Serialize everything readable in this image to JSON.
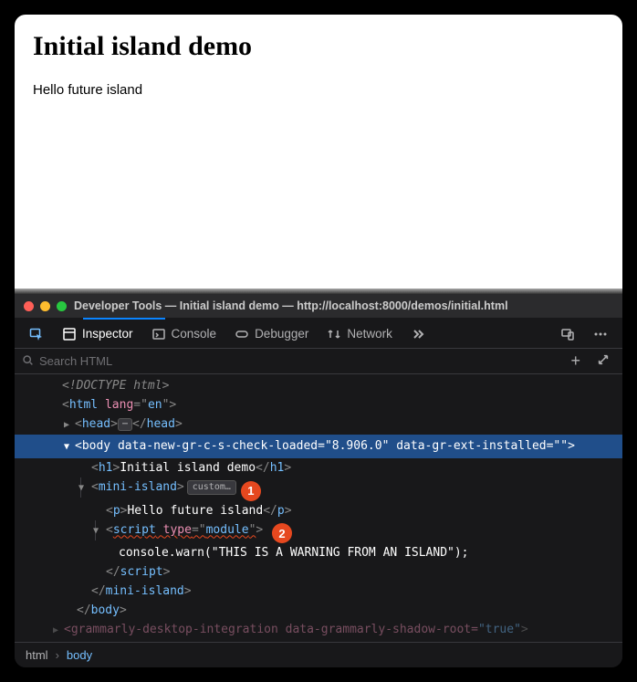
{
  "page": {
    "heading": "Initial island demo",
    "paragraph": "Hello future island"
  },
  "devtools": {
    "window_title": "Developer Tools — Initial island demo — http://localhost:8000/demos/initial.html",
    "tabs": {
      "inspector": "Inspector",
      "console": "Console",
      "debugger": "Debugger",
      "network": "Network"
    },
    "search_placeholder": "Search HTML",
    "dom": {
      "doctype": "<!DOCTYPE html>",
      "html_open_tag": "html",
      "html_lang_attr": "lang",
      "html_lang_val": "en",
      "head_tag": "head",
      "body_tag": "body",
      "body_attr1_name": "data-new-gr-c-s-check-loaded",
      "body_attr1_val": "8.906.0",
      "body_attr2_name": "data-gr-ext-installed",
      "body_attr2_val": "",
      "h1_tag": "h1",
      "h1_text": "Initial island demo",
      "mini_island_tag": "mini-island",
      "custom_badge": "custom…",
      "p_tag": "p",
      "p_text": "Hello future island",
      "script_tag": "script",
      "script_type_attr": "type",
      "script_type_val": "module",
      "console_line": "console.warn(\"THIS IS A WARNING FROM AN ISLAND\");",
      "faded_line": "<grammarly-desktop-integration data-grammarly-shadow-root=\"true\">"
    },
    "annotations": {
      "one": "1",
      "two": "2"
    },
    "breadcrumb": {
      "item1": "html",
      "item2": "body"
    }
  }
}
